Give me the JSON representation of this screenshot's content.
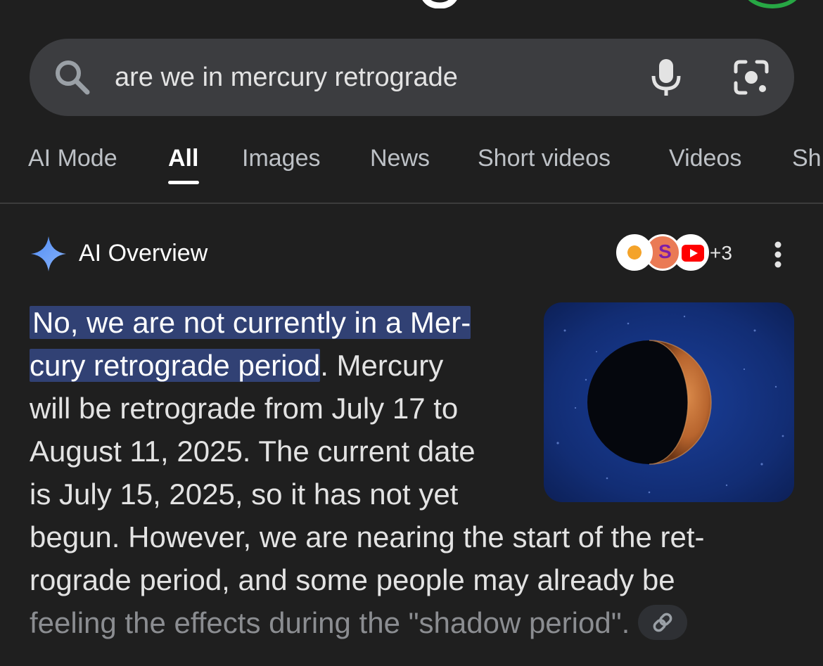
{
  "search": {
    "query": "are we in mercury retrograde"
  },
  "tabs": [
    {
      "label": "AI Mode"
    },
    {
      "label": "All"
    },
    {
      "label": "Images"
    },
    {
      "label": "News"
    },
    {
      "label": "Short videos"
    },
    {
      "label": "Videos"
    },
    {
      "label": "Sh"
    }
  ],
  "active_tab": "All",
  "ai_overview": {
    "title": "AI Overview",
    "sources_extra": "+3",
    "lines": [
      {
        "highlight": "No, we are not currently in a Mer-",
        "rest": ""
      },
      {
        "highlight": "cury retrograde period",
        "rest": ". Mercury"
      },
      {
        "highlight": "",
        "rest": "will be retrograde from July 17 to"
      },
      {
        "highlight": "",
        "rest": "August 11, 2025. The current date"
      },
      {
        "highlight": "",
        "rest": "is July 15, 2025, so it has not yet"
      },
      {
        "highlight": "",
        "rest": "begun. However, we are nearing the start of the ret-"
      },
      {
        "highlight": "",
        "rest": "rograde period, and some people may already be"
      },
      {
        "highlight": "",
        "rest": "feeling the effects during the \"shadow period\"."
      }
    ]
  },
  "icons": {
    "search": "search-icon",
    "mic": "microphone-icon",
    "lens": "camera-lens-icon",
    "sparkle": "sparkle-icon",
    "more": "more-vertical-icon",
    "link": "link-icon"
  },
  "colors": {
    "background": "#1f1f1f",
    "search_bar": "#3c3d40",
    "highlight": "#314174",
    "avatar_ring": "#27a744"
  }
}
